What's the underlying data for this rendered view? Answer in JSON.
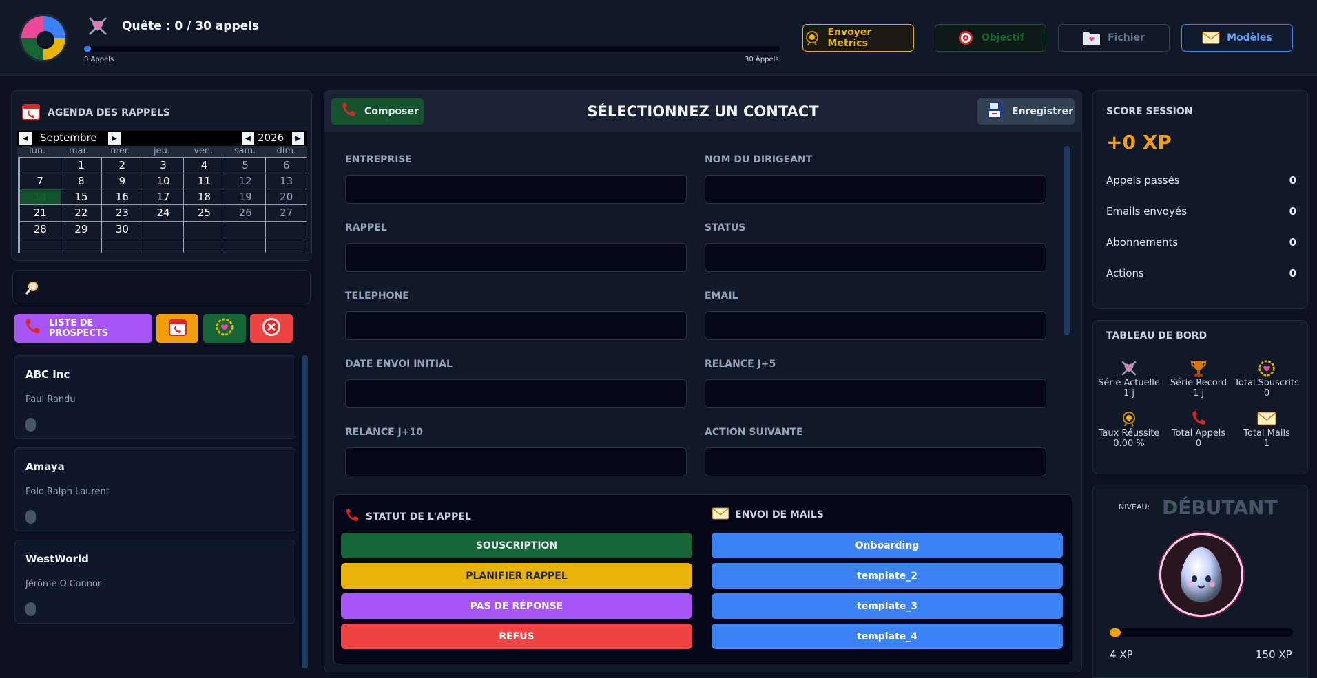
{
  "header": {
    "quest_title": "Quête : 0 / 30 appels",
    "quest_progress": 0,
    "quest_min": "0 Appels",
    "quest_max": "30 Appels",
    "buttons": {
      "metrics": "Envoyer Metrics",
      "objectif": "Objectif",
      "fichier": "Fichier",
      "modeles": "Modèles"
    }
  },
  "calendar": {
    "title": "AGENDA DES RAPPELS",
    "month": "Septembre",
    "year": "2026",
    "days_of_week": [
      "lun.",
      "mar.",
      "mer.",
      "jeu.",
      "ven.",
      "sam.",
      "dim."
    ],
    "cells": [
      "",
      "1",
      "2",
      "3",
      "4",
      "5",
      "6",
      "7",
      "8",
      "9",
      "10",
      "11",
      "12",
      "13",
      "14",
      "15",
      "16",
      "17",
      "18",
      "19",
      "20",
      "21",
      "22",
      "23",
      "24",
      "25",
      "26",
      "27",
      "28",
      "29",
      "30",
      "",
      "",
      "",
      "",
      "",
      "",
      "",
      "",
      "",
      "",
      ""
    ],
    "today": "14"
  },
  "search": {
    "placeholder": ""
  },
  "filters": {
    "prospects_label": "LISTE DE PROSPECTS"
  },
  "prospects": [
    {
      "company": "ABC Inc",
      "contact": "Paul Randu"
    },
    {
      "company": "Amaya",
      "contact": "Polo Ralph Laurent"
    },
    {
      "company": "WestWorld",
      "contact": "Jérôme O'Connor"
    }
  ],
  "main": {
    "compose_label": "Composer",
    "title": "SÉLECTIONNEZ UN CONTACT",
    "save_label": "Enregistrer",
    "fields": {
      "entreprise": "ENTREPRISE",
      "dirigeant": "NOM DU DIRIGEANT",
      "rappel": "RAPPEL",
      "status": "STATUS",
      "telephone": "TELEPHONE",
      "email": "EMAIL",
      "date_envoi": "DATE ENVOI INITIAL",
      "relance_5": "RELANCE J+5",
      "relance_10": "RELANCE J+10",
      "action_suivante": "ACTION SUIVANTE"
    },
    "values": {
      "entreprise": "",
      "dirigeant": "",
      "rappel": "",
      "status": "",
      "telephone": "",
      "email": "",
      "date_envoi": "",
      "relance_5": "",
      "relance_10": "",
      "action_suivante": ""
    },
    "call_status": {
      "title": "STATUT DE L'APPEL",
      "buttons": [
        "SOUSCRIPTION",
        "PLANIFIER RAPPEL",
        "PAS DE RÉPONSE",
        "REFUS"
      ]
    },
    "mails": {
      "title": "ENVOI DE MAILS",
      "buttons": [
        "Onboarding",
        "template_2",
        "template_3",
        "template_4"
      ]
    }
  },
  "score": {
    "title": "SCORE SESSION",
    "xp": "+0 XP",
    "rows": [
      {
        "label": "Appels passés",
        "value": "0"
      },
      {
        "label": "Emails envoyés",
        "value": "0"
      },
      {
        "label": "Abonnements",
        "value": "0"
      },
      {
        "label": "Actions",
        "value": "0"
      }
    ]
  },
  "dashboard": {
    "title": "TABLEAU DE BORD",
    "stats": [
      {
        "label": "Série Actuelle",
        "value": "1 j",
        "icon": "swords-heart-icon"
      },
      {
        "label": "Série Record",
        "value": "1 j",
        "icon": "trophy-icon"
      },
      {
        "label": "Total Souscrits",
        "value": "0",
        "icon": "laurel-heart-icon"
      },
      {
        "label": "Taux Réussite",
        "value": "0.00 %",
        "icon": "medal-icon"
      },
      {
        "label": "Total Appels",
        "value": "0",
        "icon": "phone-icon"
      },
      {
        "label": "Total Mails",
        "value": "1",
        "icon": "envelope-icon"
      }
    ]
  },
  "level": {
    "niveau_label": "NIVEAU:",
    "name": "DÉBUTANT",
    "xp_current": "4 XP",
    "xp_next": "150 XP",
    "progress": 0.027
  },
  "colors": {
    "accent_blue": "#3b82f6",
    "souscription": "#166534",
    "planifier": "#eab308",
    "pas_reponse": "#a855f7",
    "refus": "#ef4444",
    "xp_orange": "#f59e0b"
  }
}
